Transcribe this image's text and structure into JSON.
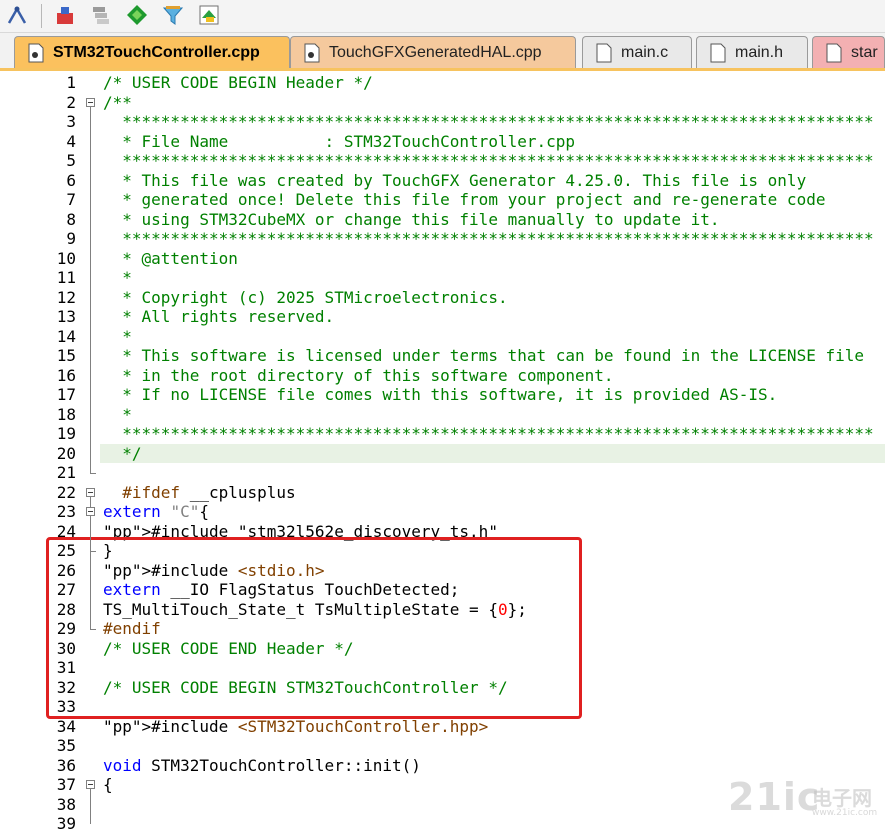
{
  "toolbar": {
    "buttons": [
      "tools-icon",
      "class-wizard-icon",
      "module-stack-icon",
      "diamond-run-icon",
      "debug-funnel-icon",
      "layers-icon"
    ]
  },
  "tabs": [
    {
      "label": "STM32TouchController.cpp",
      "active": true
    },
    {
      "label": "TouchGFXGeneratedHAL.cpp",
      "active": false
    },
    {
      "label": "main.c",
      "active": false
    },
    {
      "label": "main.h",
      "active": false
    },
    {
      "label": "star",
      "active": false
    }
  ],
  "editor": {
    "line_numbers": [
      "1",
      "2",
      "3",
      "4",
      "5",
      "6",
      "7",
      "8",
      "9",
      "10",
      "11",
      "12",
      "13",
      "14",
      "15",
      "16",
      "17",
      "18",
      "19",
      "20",
      "21",
      "22",
      "23",
      "24",
      "25",
      "26",
      "27",
      "28",
      "29",
      "30",
      "31",
      "32",
      "33",
      "34",
      "35",
      "36",
      "37",
      "38",
      "39"
    ],
    "current_line": 20,
    "lines": [
      "/* USER CODE BEGIN Header */",
      "/**",
      "  ******************************************************************************",
      "  * File Name          : STM32TouchController.cpp",
      "  ******************************************************************************",
      "  * This file was created by TouchGFX Generator 4.25.0. This file is only",
      "  * generated once! Delete this file from your project and re-generate code",
      "  * using STM32CubeMX or change this file manually to update it.",
      "  ******************************************************************************",
      "  * @attention",
      "  *",
      "  * Copyright (c) 2025 STMicroelectronics.",
      "  * All rights reserved.",
      "  *",
      "  * This software is licensed under terms that can be found in the LICENSE file",
      "  * in the root directory of this software component.",
      "  * If no LICENSE file comes with this software, it is provided AS-IS.",
      "  *",
      "  ******************************************************************************",
      "  */",
      "",
      "  #ifdef __cplusplus",
      "extern \"C\"{",
      "#include \"stm32l562e_discovery_ts.h\"",
      "}",
      "#include <stdio.h>",
      "extern __IO FlagStatus TouchDetected;",
      "TS_MultiTouch_State_t TsMultipleState = {0};",
      "#endif",
      "/* USER CODE END Header */",
      "",
      "/* USER CODE BEGIN STM32TouchController */",
      "",
      "#include <STM32TouchController.hpp>",
      "",
      "void STM32TouchController::init()",
      "{",
      "",
      ""
    ]
  },
  "watermark": {
    "brand": "21ic",
    "cn": "电子网",
    "url": "www.21ic.com"
  },
  "colors": {
    "comment": "#008000",
    "keyword": "#0000ff",
    "preprocessor": "#804000",
    "string": "#808080",
    "number": "#ff0000",
    "active_tab": "#fbc15e",
    "highlight_box": "#e02020"
  }
}
